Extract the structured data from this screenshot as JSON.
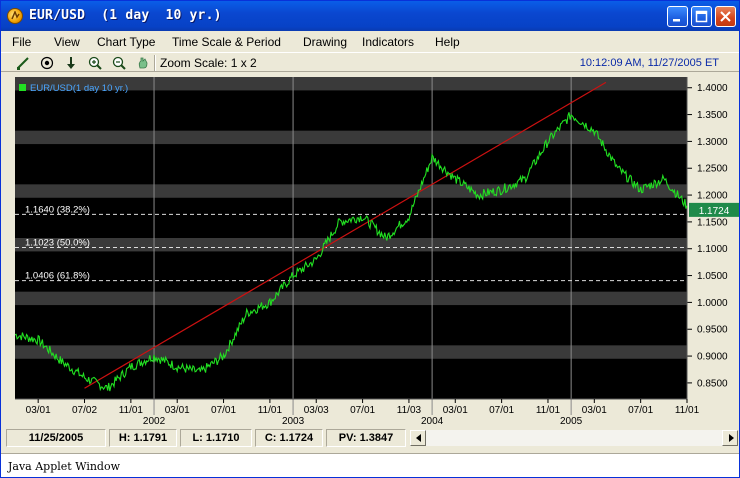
{
  "window": {
    "title": "EUR/USD  (1 day  10 yr.)"
  },
  "menubar": {
    "items": [
      {
        "label": "File"
      },
      {
        "label": "View"
      },
      {
        "label": "Chart Type"
      },
      {
        "label": "Time Scale & Period"
      },
      {
        "label": "Drawing"
      },
      {
        "label": "Indicators"
      },
      {
        "label": "Help"
      }
    ]
  },
  "toolbar": {
    "icons": [
      "draw-line-icon",
      "target-icon",
      "down-arrow-icon",
      "zoom-in-icon",
      "zoom-out-icon",
      "pan-hand-icon"
    ],
    "zoom_label": "Zoom Scale: 1 x 2",
    "datetime": "10:12:09 AM, 11/27/2005 ET"
  },
  "chart": {
    "legend_label": "EUR/USD(1 day  10 yr.)",
    "current_price_tag": "1.1724",
    "fib_levels": [
      {
        "label": "1.1640 (38.2%)",
        "value": 1.164
      },
      {
        "label": "1.1023 (50.0%)",
        "value": 1.1023
      },
      {
        "label": "1.0406 (61.8%)",
        "value": 1.0406
      }
    ],
    "colors": {
      "background": "#000000",
      "band": "#3a3a3a",
      "series": "#22e022",
      "trendline": "#cc1111",
      "price_tag_bg": "#1f8a4a",
      "legend_text": "#4aa6ff"
    }
  },
  "chart_data": {
    "type": "line",
    "series": [
      {
        "name": "EUR/USD(1 day  10 yr.)"
      }
    ],
    "y_range": [
      0.82,
      1.42
    ],
    "y_ticks": [
      "1.4000",
      "1.3500",
      "1.3000",
      "1.2500",
      "1.2000",
      "1.1500",
      "1.1000",
      "1.0500",
      "1.0000",
      "0.9500",
      "0.9000",
      "0.8500"
    ],
    "x_tick_labels": [
      "03/01",
      "07/02",
      "11/01",
      "03/01",
      "07/01",
      "11/01",
      "03/03",
      "07/01",
      "11/03",
      "03/01",
      "07/01",
      "11/01",
      "03/01",
      "07/01",
      "11/01"
    ],
    "year_labels": [
      "2002",
      "2003",
      "2004",
      "2005"
    ],
    "x": [
      "2001-01",
      "2001-03",
      "2001-05",
      "2001-07",
      "2001-09",
      "2001-11",
      "2002-01",
      "2002-03",
      "2002-05",
      "2002-07",
      "2002-09",
      "2002-11",
      "2003-01",
      "2003-03",
      "2003-05",
      "2003-07",
      "2003-09",
      "2003-11",
      "2004-01",
      "2004-03",
      "2004-05",
      "2004-07",
      "2004-09",
      "2004-11",
      "2005-01",
      "2005-03",
      "2005-05",
      "2005-07",
      "2005-09",
      "2005-11"
    ],
    "values": [
      0.94,
      0.93,
      0.89,
      0.86,
      0.84,
      0.88,
      0.9,
      0.88,
      0.87,
      0.9,
      0.98,
      1.0,
      1.05,
      1.08,
      1.15,
      1.16,
      1.12,
      1.16,
      1.27,
      1.23,
      1.2,
      1.21,
      1.23,
      1.3,
      1.35,
      1.32,
      1.25,
      1.21,
      1.23,
      1.18
    ],
    "trendline": {
      "from": [
        "2001-07",
        0.84
      ],
      "to": [
        "2005-04",
        1.41
      ]
    },
    "ylabel": "",
    "xlabel": "",
    "grid": true
  },
  "status": {
    "date": "11/25/2005",
    "high": "H: 1.1791",
    "low": "L: 1.1710",
    "close": "C: 1.1724",
    "pv": "PV: 1.3847"
  },
  "applet": {
    "text": "Java Applet Window"
  }
}
